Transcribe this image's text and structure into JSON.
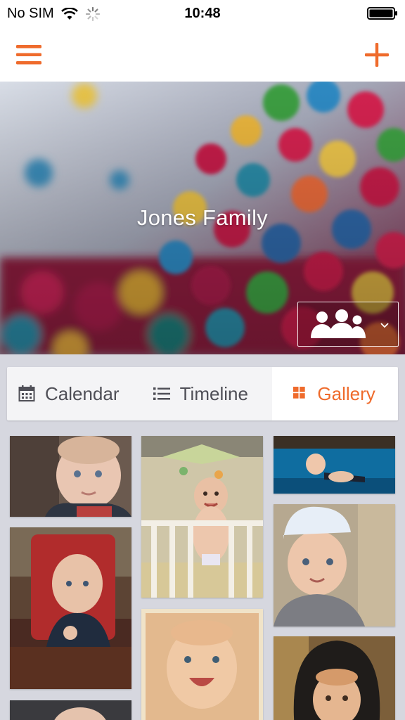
{
  "status_bar": {
    "carrier": "No SIM",
    "time": "10:48"
  },
  "nav": {
    "menu_icon": "hamburger-icon",
    "add_icon": "plus-icon",
    "accent": "#ef6b2c"
  },
  "hero": {
    "title": "Jones Family",
    "members_icon": "group-icon"
  },
  "tabs": [
    {
      "label": "Calendar",
      "icon": "calendar-icon"
    },
    {
      "label": "Timeline",
      "icon": "list-icon"
    },
    {
      "label": "Gallery",
      "icon": "grid-icon",
      "active": true
    }
  ],
  "gallery": {
    "photos": [
      {
        "description_icon": "photo-icon"
      },
      {
        "description_icon": "photo-icon"
      },
      {
        "description_icon": "photo-icon"
      },
      {
        "description_icon": "photo-icon"
      },
      {
        "description_icon": "photo-icon"
      },
      {
        "description_icon": "photo-icon"
      },
      {
        "description_icon": "photo-icon"
      },
      {
        "description_icon": "photo-icon"
      },
      {
        "description_icon": "photo-icon"
      }
    ]
  }
}
